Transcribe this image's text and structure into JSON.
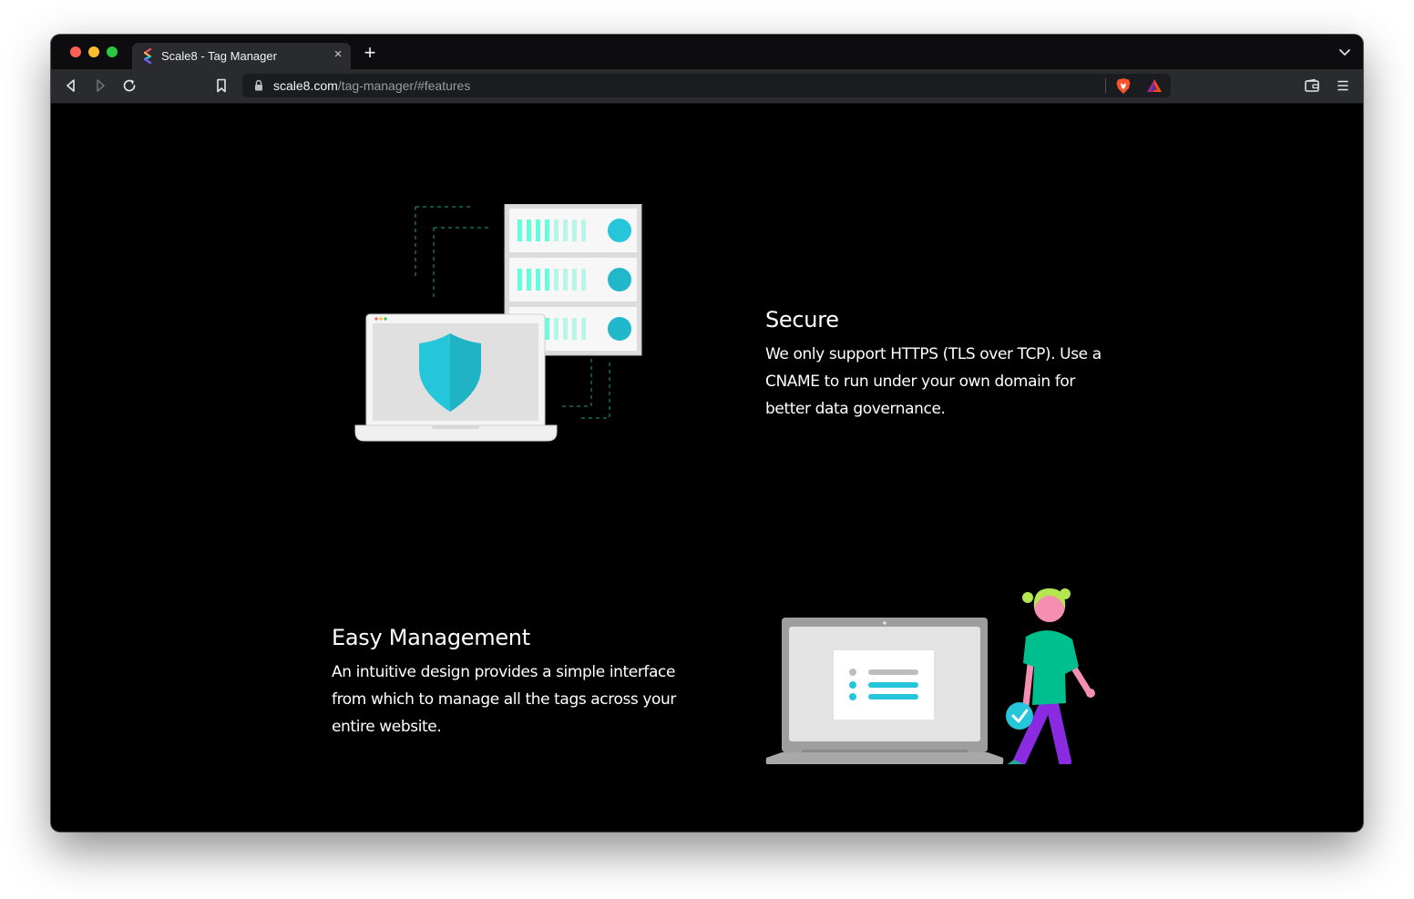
{
  "browser": {
    "tab": {
      "title": "Scale8 - Tag Manager",
      "close_label": "×"
    },
    "new_tab_label": "+",
    "address": {
      "host": "scale8.com",
      "path": "/tag-manager/#features"
    }
  },
  "features": [
    {
      "title": "Secure",
      "description": "We only support HTTPS (TLS over TCP). Use a CNAME to run under your own domain for better data governance."
    },
    {
      "title": "Easy Management",
      "description": "An intuitive design provides a simple interface from which to manage all the tags across your entire website."
    }
  ],
  "colors": {
    "accent_cyan": "#26c6da",
    "accent_mint": "#64ffda",
    "person_shirt": "#00bf8f",
    "person_pants": "#8a2be2",
    "hair": "#b5e550"
  },
  "icons": [
    "back-icon",
    "forward-icon",
    "reload-icon",
    "bookmark-icon",
    "lock-icon",
    "brave-shield-icon",
    "brave-rewards-icon",
    "wallet-icon",
    "menu-icon",
    "chevron-down-icon"
  ]
}
